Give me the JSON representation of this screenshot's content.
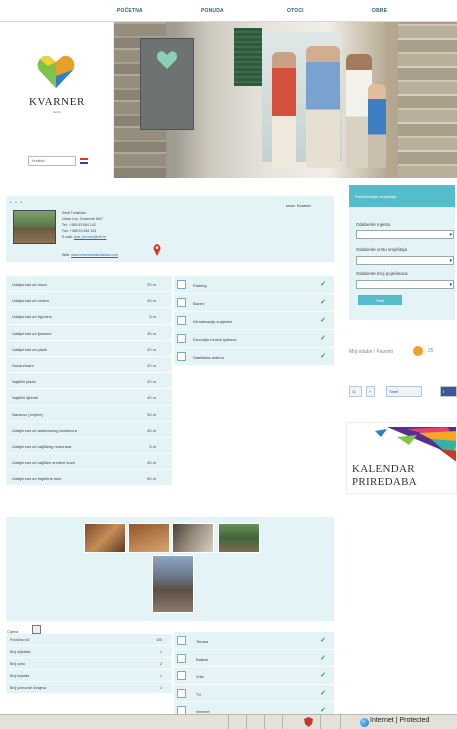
{
  "nav": {
    "items": [
      "POČETNA",
      "PONUDA",
      "OTOCI",
      "OBRE"
    ]
  },
  "brand": {
    "name": "KVARNER",
    "sub": "family",
    "lang_value": "Hrvatski",
    "sign_text": "KVARNER"
  },
  "info": {
    "dots": "• • •",
    "right_label": "Izvor: Kvarner",
    "lines": [
      "Kristi Turistička",
      "Uvala Lun, Tovarnele 6A/7",
      "Tel.: +385 53 654 142",
      "Fax: +385 53 654 125",
      "E-mail: "
    ],
    "email": "kvar_turizam@net.hr",
    "web_label": "Web: ",
    "web": "www.kvarnerskaturisticka.com"
  },
  "distances": [
    {
      "label": "Udaljenost od mora",
      "value": "20 m"
    },
    {
      "label": "Udaljenost od centra",
      "value": "30 m"
    },
    {
      "label": "Udaljenost od trgovine",
      "value": "5 m"
    },
    {
      "label": "Udaljenost od ljekarne",
      "value": "30 m"
    },
    {
      "label": "Udaljenost od plaže",
      "value": "20 m"
    },
    {
      "label": "Dućan/marn",
      "value": "20 m"
    },
    {
      "label": "Najbliži plaža",
      "value": "20 m"
    },
    {
      "label": "Najbliži liječnik",
      "value": "40 m"
    },
    {
      "label": "Naravno (mvjere)",
      "value": "30 m"
    },
    {
      "label": "Udaljenost od autobusnog kolodvora",
      "value": "40 m"
    },
    {
      "label": "Udaljenost od najbližeg restorana",
      "value": "5 m"
    },
    {
      "label": "Udaljenost od najbliže sredine kuće",
      "value": "40 m"
    },
    {
      "label": "Udaljenost od trajektne luke",
      "value": "50 m"
    }
  ],
  "amenities": [
    {
      "label": "Parking"
    },
    {
      "label": "Bazen"
    },
    {
      "label": "Klimatizacija susjedne"
    },
    {
      "label": "Dozvoljeni kućni ljubimci"
    },
    {
      "label": "Satelitska antena"
    }
  ],
  "features": {
    "price_label": "Cijena",
    "rows": [
      {
        "label": "Površina m2",
        "value": "100"
      },
      {
        "label": "Broj objekata",
        "value": "1"
      },
      {
        "label": "Broj soba",
        "value": "2"
      },
      {
        "label": "Broj kupatila",
        "value": "1"
      },
      {
        "label": "Broj pomoćnih ležajeva",
        "value": "1"
      }
    ]
  },
  "amenities2": [
    {
      "label": "Terasa"
    },
    {
      "label": "Balkon"
    },
    {
      "label": "Vrtić"
    },
    {
      "label": "TV"
    },
    {
      "label": "Internet"
    }
  ],
  "search": {
    "title": "Pretraživanje smještaja",
    "labels": [
      "Odaberite mjesto",
      "Odaberite vrstu smještaja",
      "Odaberite broj pojedinaca"
    ],
    "button": "Traži"
  },
  "favorites": {
    "label": "Moj odabir / Favoriti",
    "count": "25"
  },
  "social": {
    "b1": "11",
    "b2": "+",
    "b3": "Tweet",
    "b4": "f"
  },
  "kalendar": {
    "line1": "KALENDAR",
    "line2": "PRIREDABA"
  },
  "statusbar": {
    "zone": "Internet | Protected"
  },
  "colors": {
    "accent": "#55bccc",
    "panel": "#e4f3f5",
    "tick": "#27a04b",
    "pin": "#d43a2a"
  }
}
